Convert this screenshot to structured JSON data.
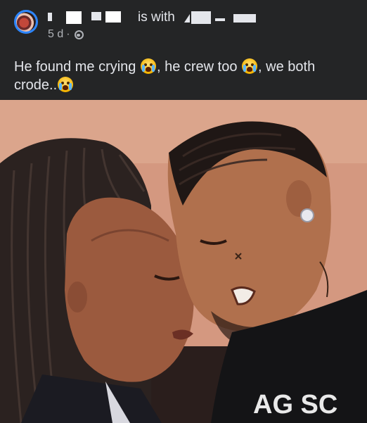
{
  "post": {
    "author_name_redacted": true,
    "with_text": "is with",
    "time": "5 d",
    "time_separator": "·",
    "privacy_icon": "globe-icon",
    "caption_parts": [
      "He found me crying ",
      ", he crew too ",
      ", we both crode..",
      ""
    ],
    "emoji": "loudly-crying-face"
  },
  "photo": {
    "shirt_text": "AG SC",
    "colors": {
      "background": "#242526",
      "text_primary": "#e4e6eb",
      "text_secondary": "#b0b3b8",
      "avatar_ring": "#2d86ff"
    }
  }
}
